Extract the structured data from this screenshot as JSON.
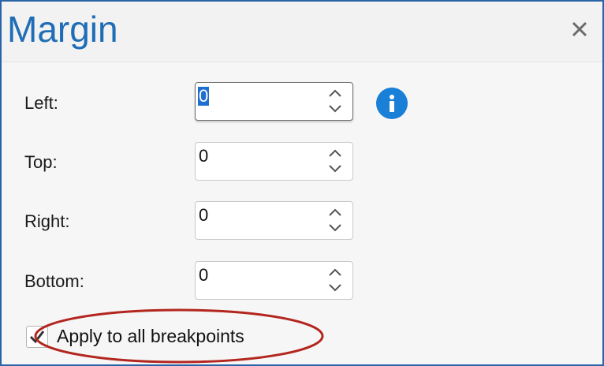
{
  "dialog": {
    "title": "Margin",
    "close_icon": "close-icon"
  },
  "fields": [
    {
      "label": "Left:",
      "value": "0",
      "selected": true
    },
    {
      "label": "Top:",
      "value": "0"
    },
    {
      "label": "Right:",
      "value": "0"
    },
    {
      "label": "Bottom:",
      "value": "0"
    }
  ],
  "info_icon": "info-icon",
  "checkbox": {
    "label": "Apply to all breakpoints",
    "checked": true
  },
  "colors": {
    "title": "#1f6db6",
    "accent_border": "#2a64a8",
    "info": "#1a7fd6",
    "selection": "#1e6fd0",
    "annotation": "#b3261e"
  }
}
